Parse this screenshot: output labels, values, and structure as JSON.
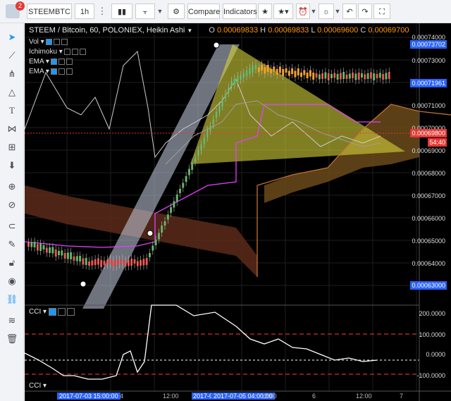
{
  "toolbar": {
    "notification_count": "2",
    "symbol": "STEEMBTC",
    "interval": "1h",
    "compare_label": "Compare",
    "indicators_label": "Indicators"
  },
  "chart": {
    "title": "STEEM / Bitcoin, 60, POLONIEX, Heikin Ashi",
    "ohlc": {
      "o_label": "O",
      "o": "0.00069833",
      "h_label": "H",
      "h": "0.00069833",
      "l_label": "L",
      "l": "0.00069600",
      "c_label": "C",
      "c": "0.00069700"
    },
    "indicators": [
      "Vol",
      "Ichimoku",
      "EMA",
      "EMA"
    ],
    "price_labels": [
      "0.00074000",
      "0.00073702",
      "0.00073000",
      "0.00071961",
      "0.00071000",
      "0.00070000",
      "0.00069800",
      "0.00069000",
      "0.00068000",
      "0.00067000",
      "0.00066000",
      "0.00065000",
      "0.00064000",
      "0.00063000"
    ],
    "highlight_labels": {
      "top": "0.00073702",
      "mid": "0.00071961",
      "last": "0.00069800",
      "countdown": "54:40",
      "bottom": "0.00063000"
    },
    "cci": {
      "label": "CCI",
      "levels": [
        "200.0000",
        "100.0000",
        "0.0000",
        "-100.0000"
      ]
    },
    "cci_bottom_label": "CCI",
    "time_labels": [
      "2017-07-03 15:00:00",
      "4",
      "12:00",
      "2017-0",
      "2017-07-05 04:00:00",
      "12:00",
      "6",
      "12:00",
      "7"
    ],
    "colors": {
      "up": "#4caf50",
      "down": "#e53935",
      "cloud_green": "#556b2f",
      "cloud_red": "#5a2a1a",
      "triangle": "#d6d23a",
      "channel": "#c8d2e6"
    }
  }
}
